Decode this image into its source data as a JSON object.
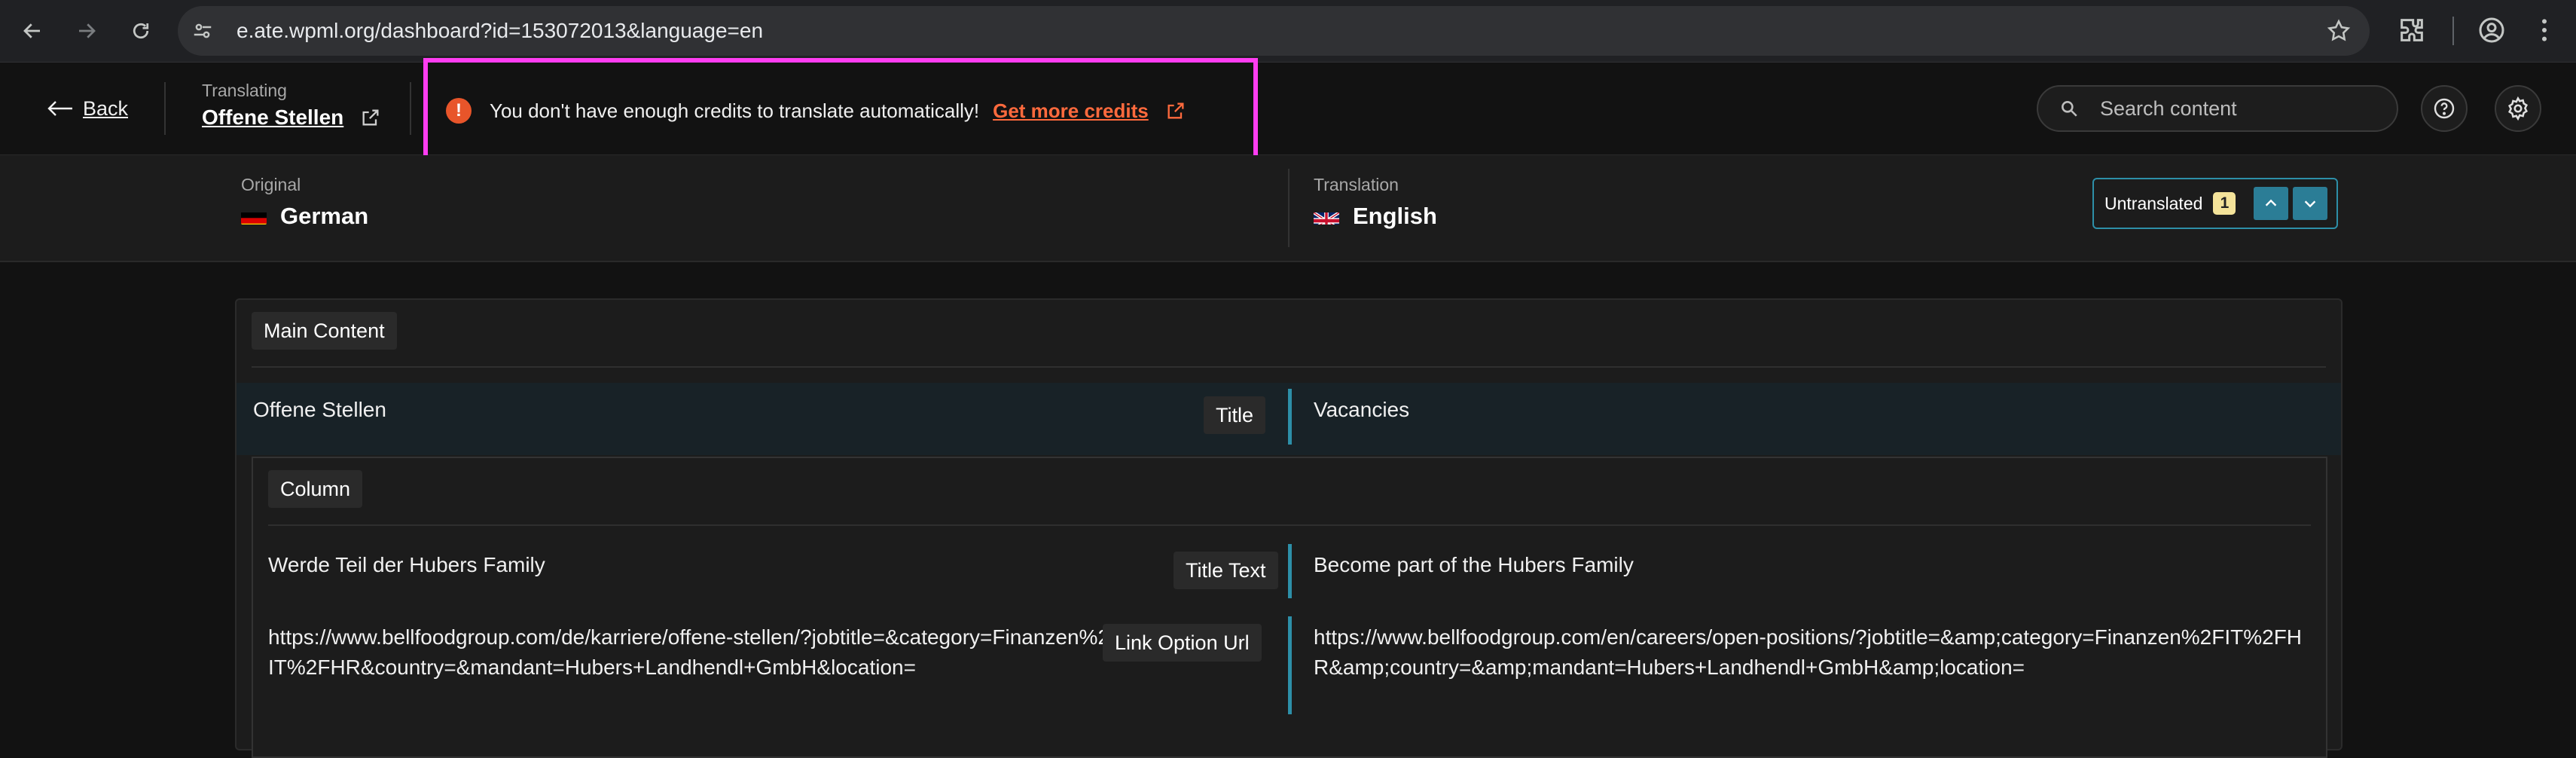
{
  "browser": {
    "url": "e.ate.wpml.org/dashboard?id=153072013&language=en"
  },
  "header": {
    "back_label": "Back",
    "translating_label": "Translating",
    "page_title": "Offene Stellen",
    "warning_text": "You don't have enough credits to translate automatically!",
    "credits_link": "Get more credits",
    "search_placeholder": "Search content"
  },
  "languages": {
    "original_label": "Original",
    "original_lang": "German",
    "translation_label": "Translation",
    "translation_lang": "English",
    "filter_label": "Untranslated",
    "filter_count": "1"
  },
  "content": {
    "section_label": "Main Content",
    "title_row": {
      "source": "Offene Stellen",
      "field": "Title",
      "target": "Vacancies"
    },
    "column_label": "Column",
    "rows": [
      {
        "source": "Werde Teil der Hubers Family",
        "field": "Title Text",
        "target": "Become part of the Hubers Family"
      },
      {
        "source": "https://www.bellfoodgroup.com/de/karriere/offene-stellen/?jobtitle=&category=Finanzen%2FIT%2FHR&country=&mandant=Hubers+Landhendl+GmbH&location=",
        "field": "Link Option Url",
        "target": "https://www.bellfoodgroup.com/en/careers/open-positions/?jobtitle=&amp;category=Finanzen%2FIT%2FHR&amp;country=&amp;mandant=Hubers+Landhendl+GmbH&amp;location="
      }
    ]
  },
  "colors": {
    "accent": "#2d8fa8",
    "warning": "#e8552a",
    "link": "#ff6a3d",
    "highlight_box": "#ff3df1"
  },
  "icons": [
    "back-arrow-icon",
    "forward-arrow-icon",
    "reload-icon",
    "site-settings-icon",
    "star-icon",
    "extensions-icon",
    "profile-icon",
    "menu-icon",
    "arrow-left-icon",
    "external-link-icon",
    "alert-icon",
    "search-icon",
    "help-icon",
    "gear-icon",
    "german-flag-icon",
    "uk-flag-icon",
    "chevron-up-icon",
    "chevron-down-icon"
  ]
}
